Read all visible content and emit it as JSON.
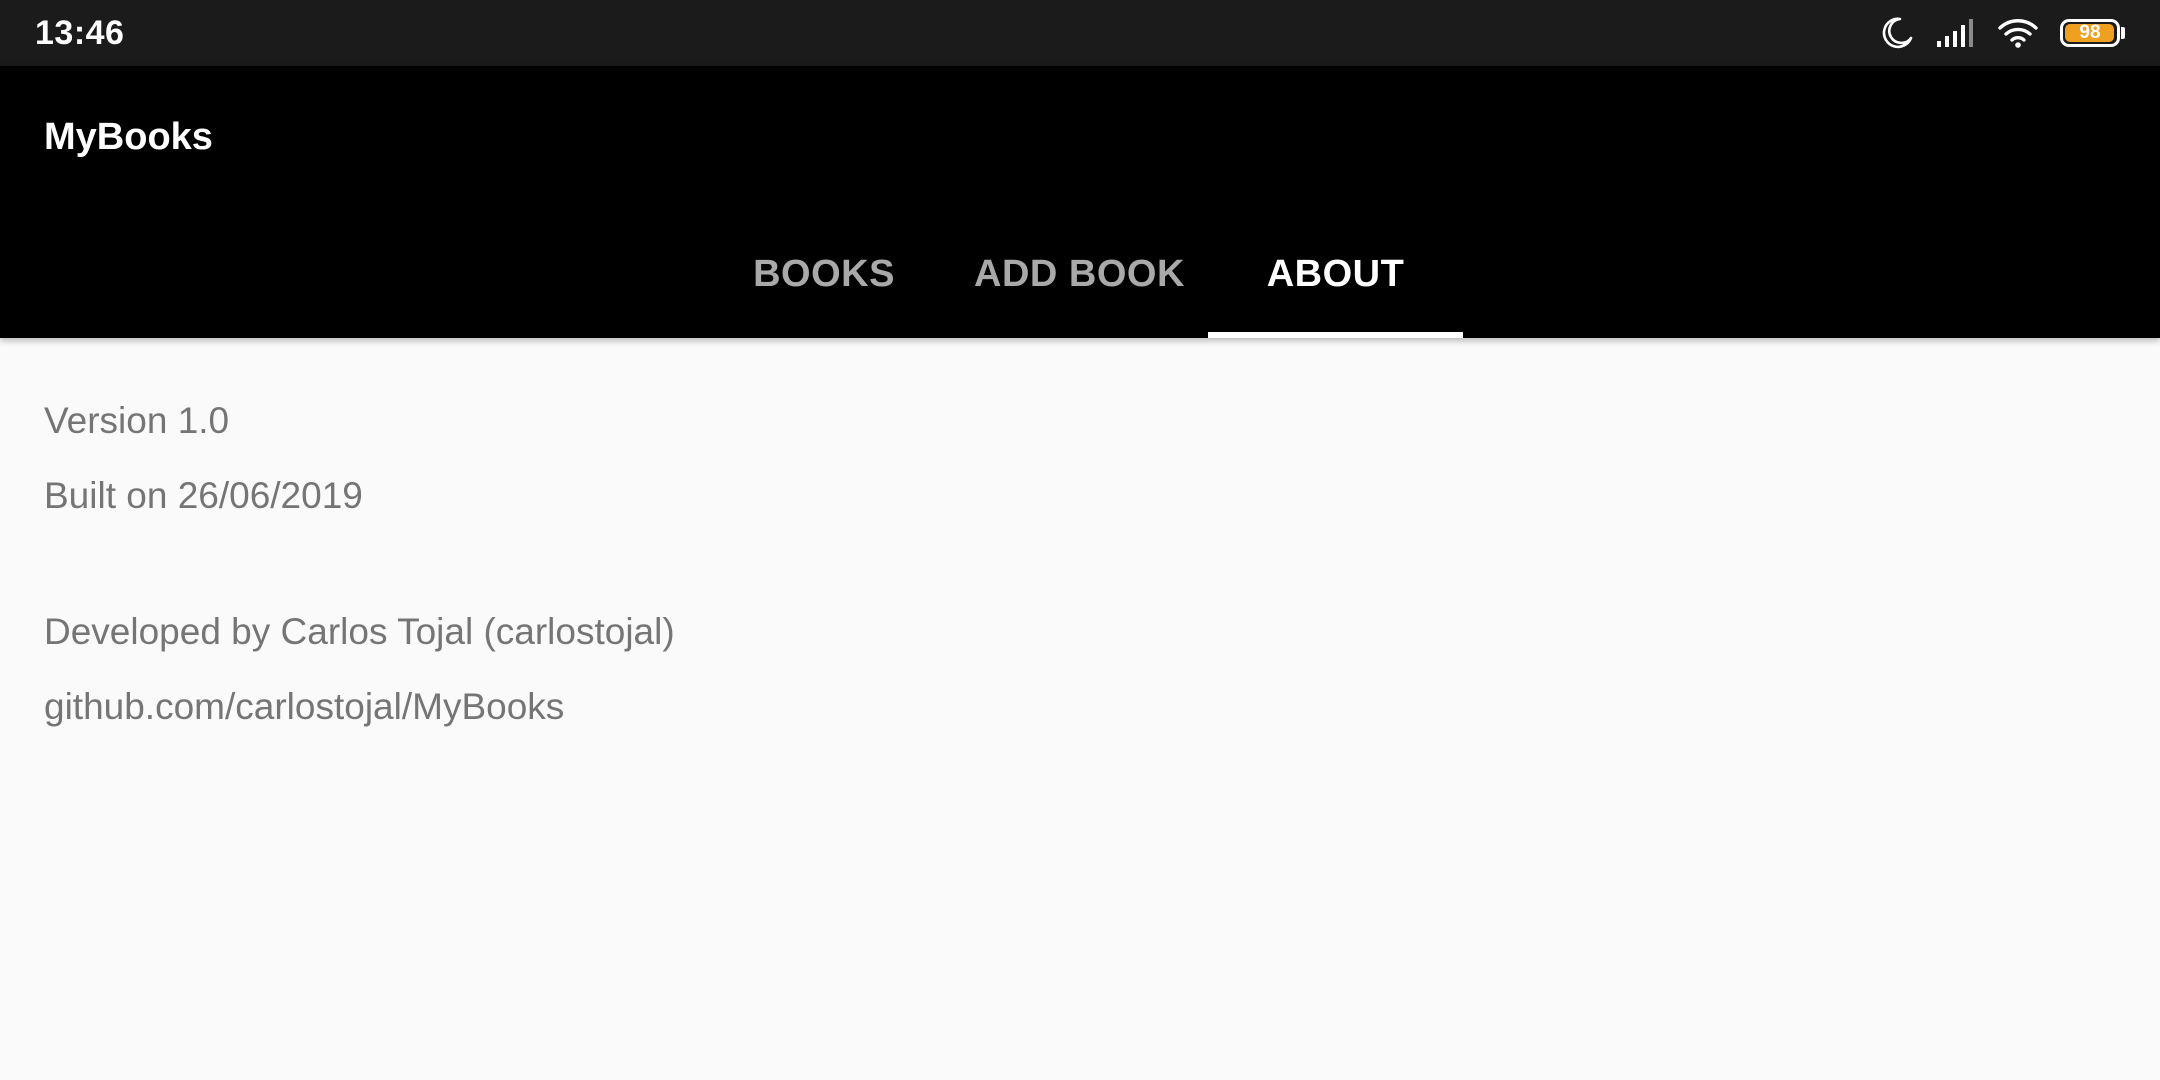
{
  "status_bar": {
    "time": "13:46",
    "icons": [
      "moon-icon",
      "signal-icon",
      "wifi-icon",
      "battery-icon"
    ],
    "battery_level": "98",
    "battery_color": "#f0a020"
  },
  "app_bar": {
    "title": "MyBooks",
    "background": "#000000"
  },
  "tabs": [
    {
      "label": "BOOKS",
      "active": false
    },
    {
      "label": "ADD BOOK",
      "active": false
    },
    {
      "label": "ABOUT",
      "active": true
    }
  ],
  "about": {
    "version": "Version 1.0",
    "built": "Built on 26/06/2019",
    "developer": "Developed by Carlos Tojal (carlostojal)",
    "repo": "github.com/carlostojal/MyBooks"
  }
}
